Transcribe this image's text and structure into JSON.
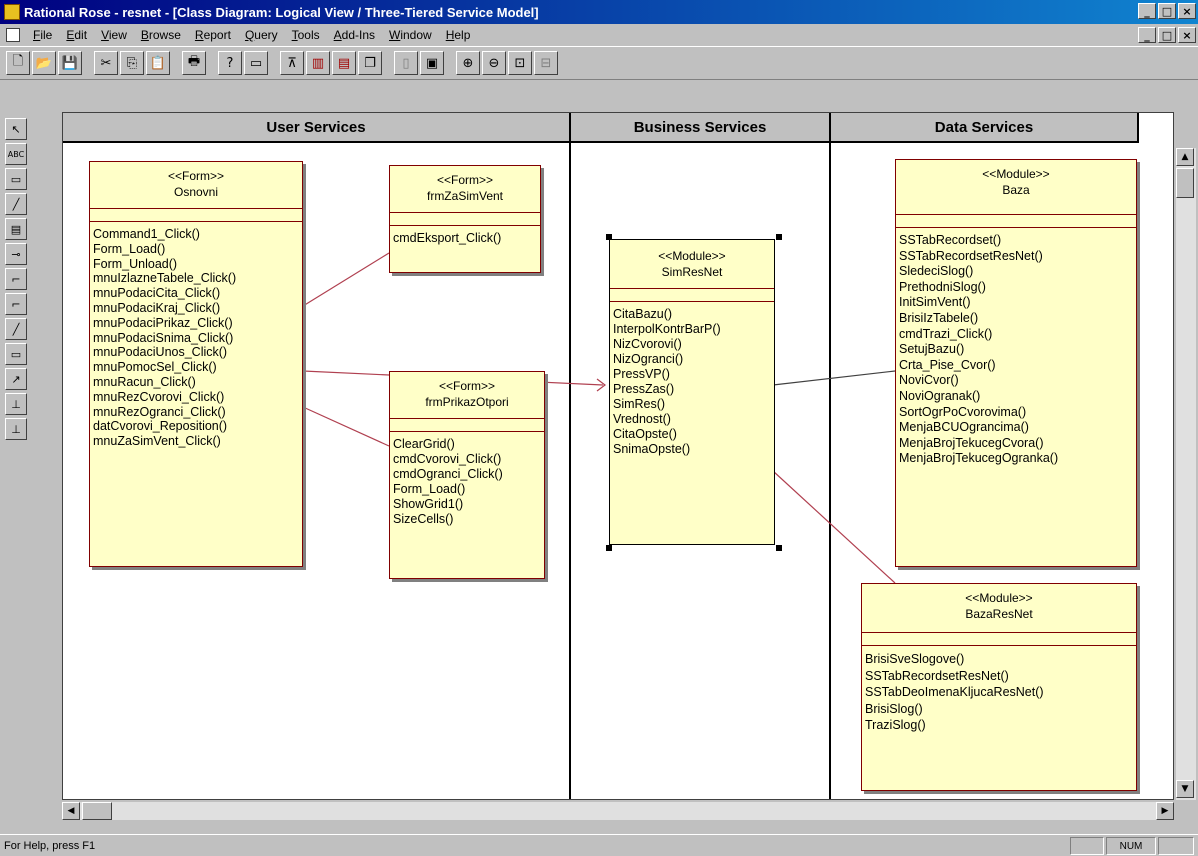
{
  "window": {
    "title": "Rational Rose - resnet - [Class Diagram: Logical View / Three-Tiered Service Model]",
    "buttons": [
      "_",
      "□",
      "×"
    ]
  },
  "menu": {
    "items": [
      "File",
      "Edit",
      "View",
      "Browse",
      "Report",
      "Query",
      "Tools",
      "Add-Ins",
      "Window",
      "Help"
    ]
  },
  "toolbar": {
    "icons": [
      "new-icon",
      "open-icon",
      "save-icon",
      "cut-icon",
      "copy-icon",
      "paste-icon",
      "print-icon",
      "help-icon",
      "view-icon",
      "browse-class-icon",
      "browse-interaction-icon",
      "browse-component-icon",
      "browse-deployment-icon",
      "previous-diagram-icon",
      "fit-icon",
      "zoom-in-icon",
      "zoom-out-icon",
      "fit-window-icon",
      "undo-fit-icon"
    ]
  },
  "swimlanes": [
    "User Services",
    "Business Services",
    "Data Services"
  ],
  "classes": {
    "osnovni": {
      "stereotype": "<<Form>>",
      "name": "Osnovni",
      "operations": [
        "Command1_Click()",
        "Form_Load()",
        "Form_Unload()",
        "mnuIzlazneTabele_Click()",
        "mnuPodaciCita_Click()",
        "mnuPodaciKraj_Click()",
        "mnuPodaciPrikaz_Click()",
        "mnuPodaciSnima_Click()",
        "mnuPodaciUnos_Click()",
        "mnuPomocSel_Click()",
        "mnuRacun_Click()",
        "mnuRezCvorovi_Click()",
        "mnuRezOgranci_Click()",
        "datCvorovi_Reposition()",
        "mnuZaSimVent_Click()"
      ]
    },
    "frmZaSimVent": {
      "stereotype": "<<Form>>",
      "name": "frmZaSimVent",
      "operations": [
        "cmdEksport_Click()"
      ]
    },
    "frmPrikazOtpori": {
      "stereotype": "<<Form>>",
      "name": "frmPrikazOtpori",
      "operations": [
        "ClearGrid()",
        "cmdCvorovi_Click()",
        "cmdOgranci_Click()",
        "Form_Load()",
        "ShowGrid1()",
        "SizeCells()"
      ]
    },
    "simResNet": {
      "stereotype": "<<Module>>",
      "name": "SimResNet",
      "operations": [
        "CitaBazu()",
        "InterpolKontrBarP()",
        "NizCvorovi()",
        "NizOgranci()",
        "PressVP()",
        "PressZas()",
        "SimRes()",
        "Vrednost()",
        "CitaOpste()",
        "SnimaOpste()"
      ]
    },
    "baza": {
      "stereotype": "<<Module>>",
      "name": "Baza",
      "operations": [
        "SSTabRecordset()",
        "SSTabRecordsetResNet()",
        "SledeciSlog()",
        "PrethodniSlog()",
        "InitSimVent()",
        "BrisiIzTabele()",
        "cmdTrazi_Click()",
        "SetujBazu()",
        "Crta_Pise_Cvor()",
        "NoviCvor()",
        "NoviOgranak()",
        "SortOgrPoCvorovima()",
        "MenjaBCUOgrancima()",
        "MenjaBrojTekucegCvora()",
        "MenjaBrojTekucegOgranka()"
      ]
    },
    "bazaResNet": {
      "stereotype": "<<Module>>",
      "name": "BazaResNet",
      "operations": [
        "BrisiSveSlogove()",
        "SSTabRecordsetResNet()",
        "SSTabDeoImenaKljucaResNet()",
        "BrisiSlog()",
        "TraziSlog()"
      ]
    }
  },
  "statusbar": {
    "help": "For Help, press F1",
    "mode": "NUM"
  }
}
